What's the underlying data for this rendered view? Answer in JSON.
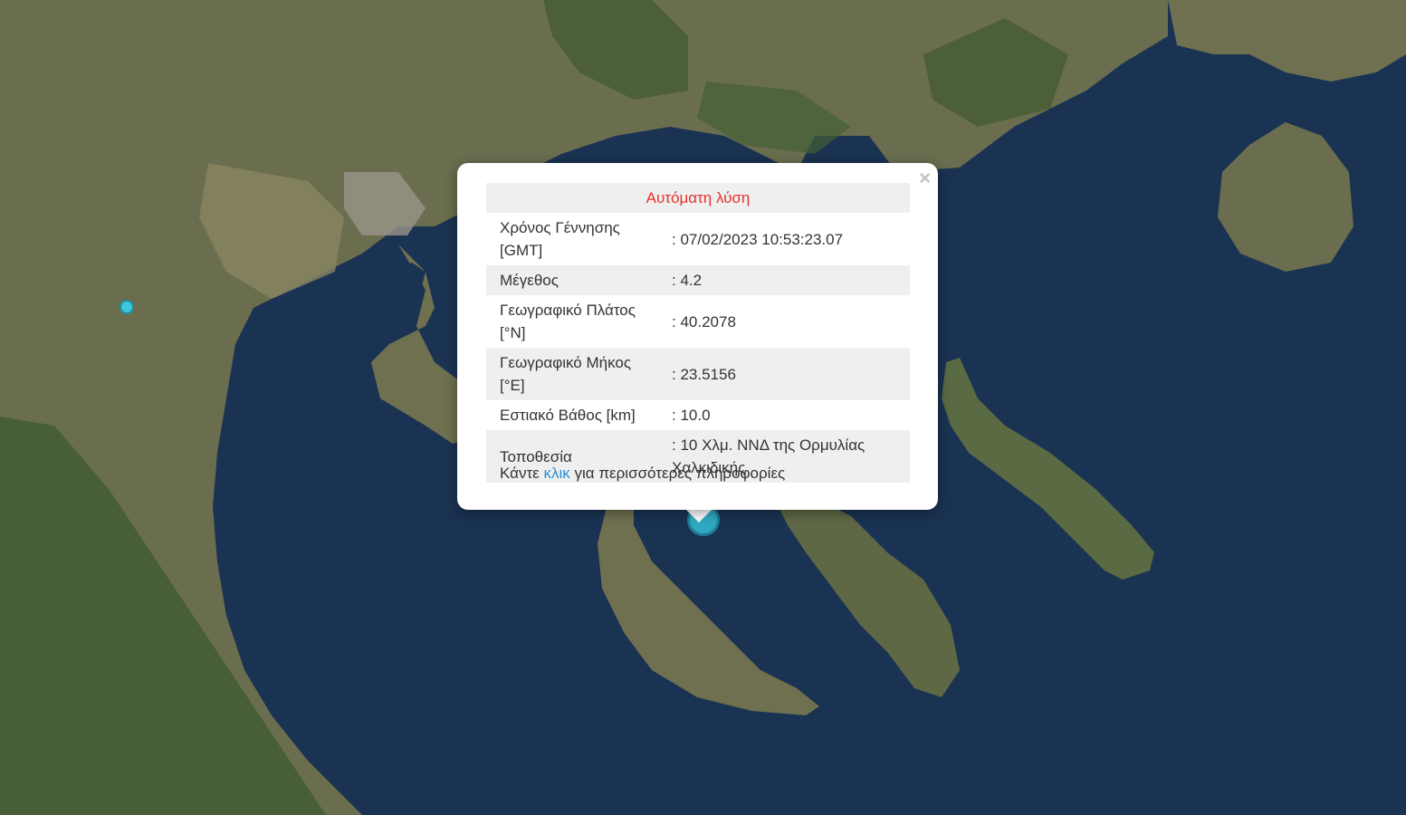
{
  "map": {
    "colors": {
      "sea": "#1a3352",
      "land": "#6b6d4f",
      "forest": "#3e5a2f",
      "plain": "#8a8460",
      "urban": "#9a9489",
      "marker": "#2fa9c0"
    }
  },
  "popup": {
    "title": "Αυτόματη λύση",
    "close_icon": "×",
    "rows": [
      {
        "label": "Χρόνος Γέννησης [GMT]",
        "value": ": 07/02/2023 10:53:23.07"
      },
      {
        "label": "Μέγεθος",
        "value": ": 4.2"
      },
      {
        "label": "Γεωγραφικό Πλάτος [°N]",
        "value": ": 40.2078"
      },
      {
        "label": "Γεωγραφικό Μήκος [°E]",
        "value": ": 23.5156"
      },
      {
        "label": "Εστιακό Βάθος [km]",
        "value": ": 10.0"
      },
      {
        "label": "Τοποθεσία",
        "value": ": 10 Χλμ. ΝΝΔ της Ορμυλίας Χαλκιδικής"
      }
    ],
    "more_prefix": "Κάντε ",
    "more_link": "κλικ",
    "more_suffix": " για περισσότερες πληροφορίες"
  }
}
